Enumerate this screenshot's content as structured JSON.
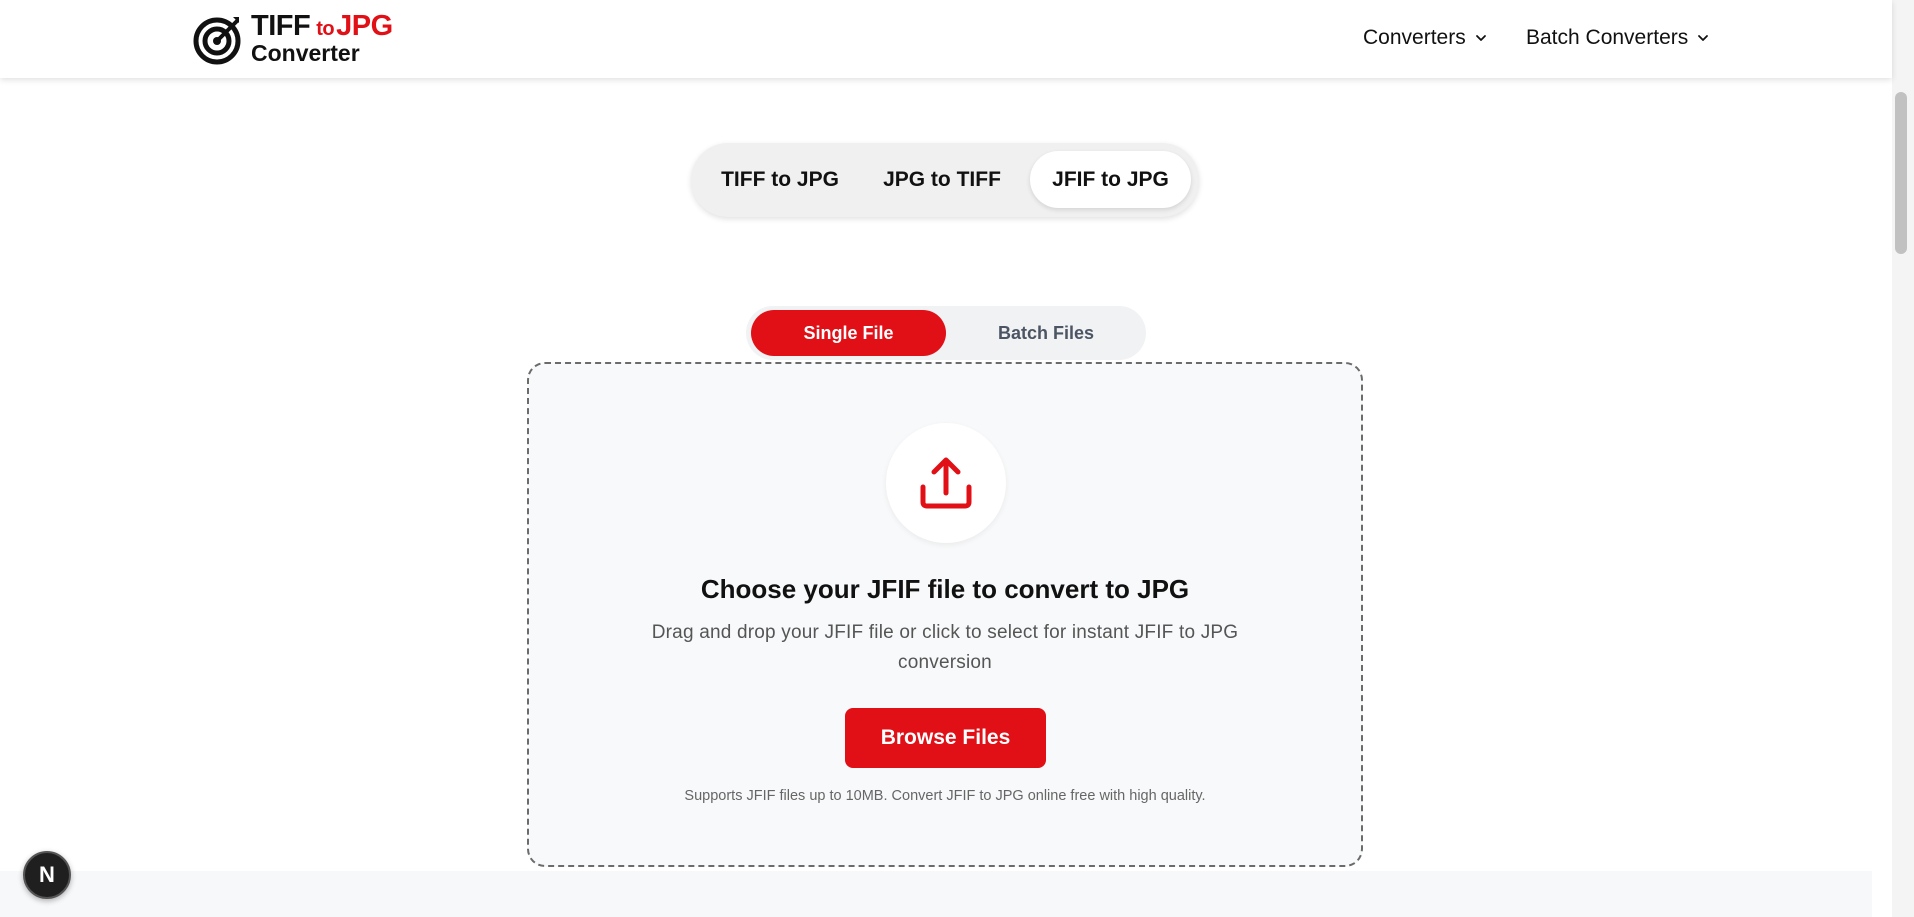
{
  "brand": {
    "line1_part1": "TIFF",
    "line1_part2": "to",
    "line1_part3": "JPG",
    "line2": "Converter",
    "accent_color": "#e10f16"
  },
  "nav": {
    "converters": "Converters",
    "batch_converters": "Batch Converters"
  },
  "converter_tabs": [
    {
      "label": "TIFF to JPG",
      "active": false
    },
    {
      "label": "JPG to TIFF",
      "active": false
    },
    {
      "label": "JFIF to JPG",
      "active": true
    }
  ],
  "mode_toggle": {
    "single": "Single File",
    "batch": "Batch Files",
    "selected": "Single File"
  },
  "dropzone": {
    "icon": "upload-icon",
    "title": "Choose your JFIF file to convert to JPG",
    "description": "Drag and drop your JFIF file or click to select for instant JFIF to JPG conversion",
    "button": "Browse Files",
    "note": "Supports JFIF files up to 10MB. Convert JFIF to JPG online free with high quality."
  },
  "badge": {
    "letter": "N"
  }
}
